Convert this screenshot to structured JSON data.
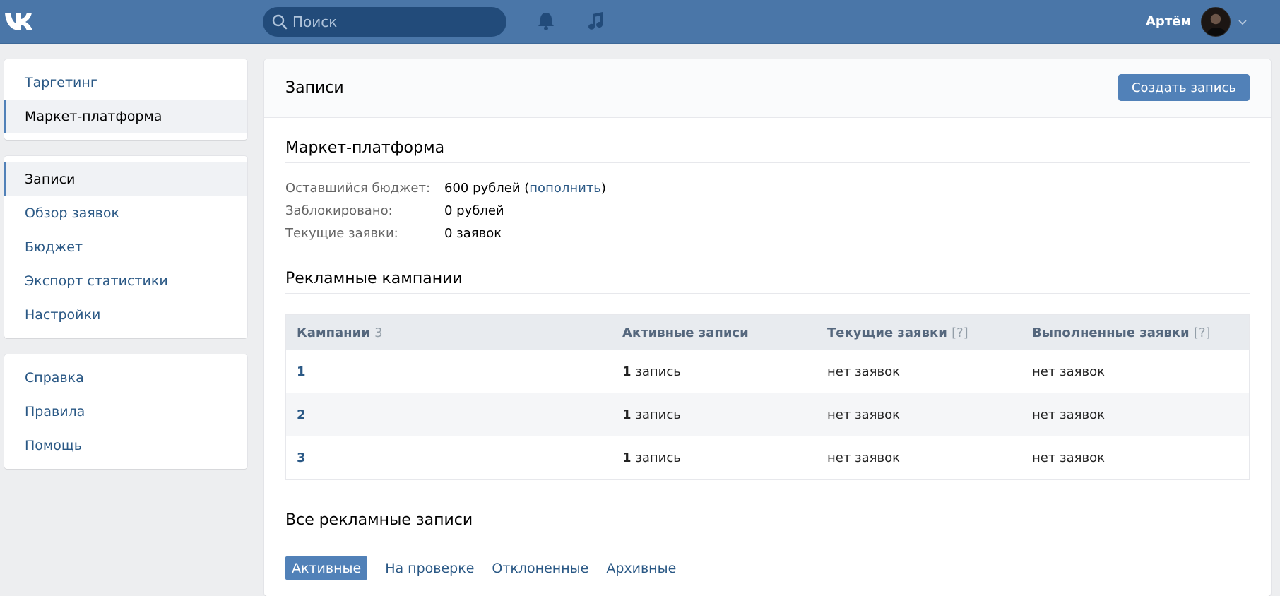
{
  "header": {
    "logo": "vk-logo",
    "search_placeholder": "Поиск",
    "icons": [
      "bell-icon",
      "music-icon"
    ],
    "user_name": "Артём",
    "colors": {
      "bar": "#4a76a8",
      "search": "#224b7a"
    }
  },
  "sidebar": {
    "block1": [
      {
        "label": "Таргетинг"
      },
      {
        "label": "Маркет-платформа",
        "selected": true
      }
    ],
    "block2": [
      {
        "label": "Записи",
        "selected": true
      },
      {
        "label": "Обзор заявок"
      },
      {
        "label": "Бюджет"
      },
      {
        "label": "Экспорт статистики"
      },
      {
        "label": "Настройки"
      }
    ],
    "block3": [
      {
        "label": "Справка"
      },
      {
        "label": "Правила"
      },
      {
        "label": "Помощь"
      }
    ]
  },
  "main": {
    "title": "Записи",
    "create_button": "Создать запись",
    "market": {
      "title": "Маркет-платформа",
      "budget_label": "Оставшийся бюджет:",
      "budget_value": "600 рублей (",
      "budget_link": "пополнить",
      "budget_close": ")",
      "blocked_label": "Заблокировано:",
      "blocked_value": "0 рублей",
      "requests_label": "Текущие заявки:",
      "requests_value": "0 заявок"
    },
    "campaigns": {
      "title": "Рекламные кампании",
      "columns": {
        "campaigns": "Кампании",
        "campaigns_count": "3",
        "active": "Активные записи",
        "current": "Текущие заявки",
        "done": "Выполненные заявки",
        "help": "[?]"
      },
      "rows": [
        {
          "id": "1",
          "active_count": "1",
          "active_unit": " запись",
          "current": "нет заявок",
          "done": "нет заявок"
        },
        {
          "id": "2",
          "active_count": "1",
          "active_unit": " запись",
          "current": "нет заявок",
          "done": "нет заявок"
        },
        {
          "id": "3",
          "active_count": "1",
          "active_unit": " запись",
          "current": "нет заявок",
          "done": "нет заявок"
        }
      ]
    },
    "all_posts": {
      "title": "Все рекламные записи",
      "tabs": [
        "Активные",
        "На проверке",
        "Отклоненные",
        "Архивные"
      ],
      "active_tab": 0
    }
  }
}
